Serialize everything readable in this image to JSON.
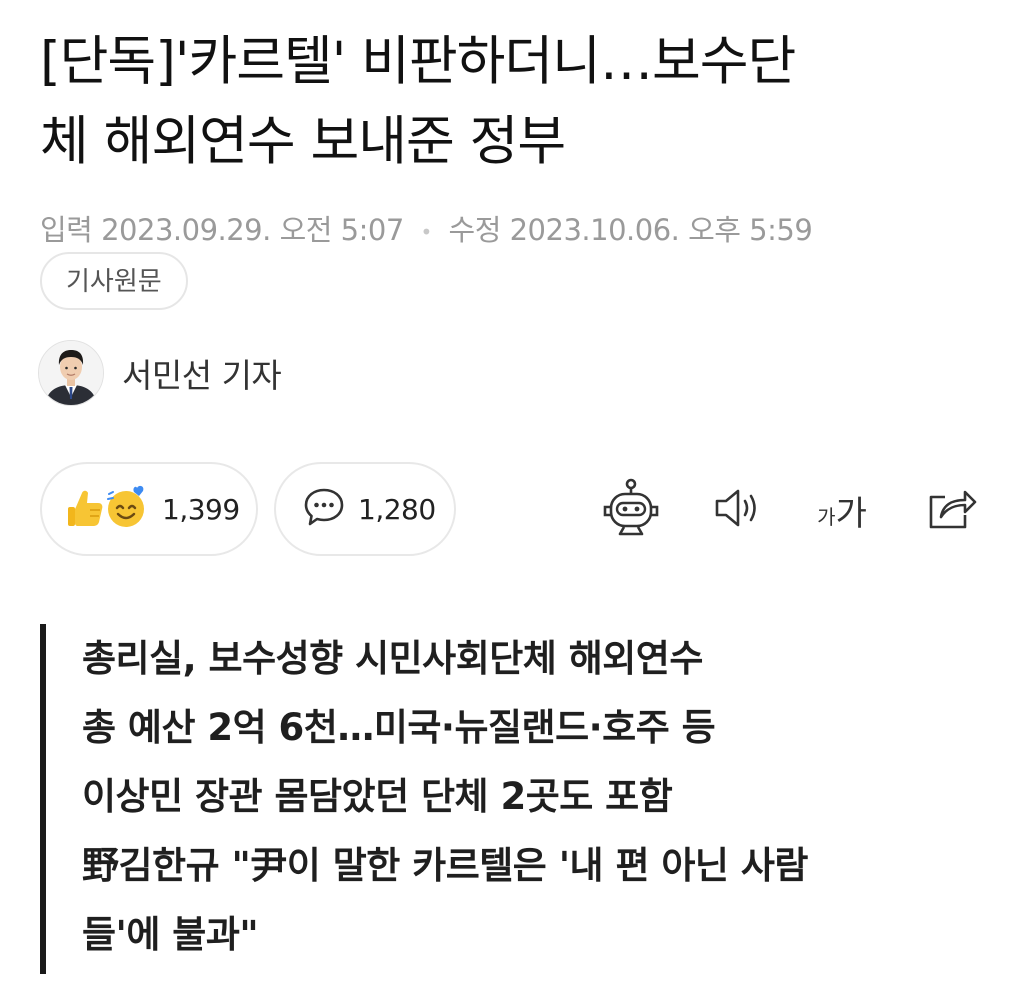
{
  "article": {
    "headline_line1": "[단독]'카르텔' 비판하더니…보수단",
    "headline_line2": "체 해외연수 보내준 정부",
    "input_label": "입력",
    "input_datetime": "2023.09.29. 오전 5:07",
    "modified_label": "수정",
    "modified_datetime": "2023.10.06. 오후 5:59",
    "source_button_label": "기사원문"
  },
  "author": {
    "name": "서민선 기자",
    "avatar_icon": "reporter-photo"
  },
  "reactions": {
    "reaction_count": "1,399",
    "comment_count": "1,280",
    "reaction_icons": [
      "thumbs-up-emoji-icon",
      "smile-emoji-icon"
    ],
    "comment_icon": "speech-bubble-icon"
  },
  "toolbar": {
    "bot_icon": "robot-summary-icon",
    "speaker_icon": "speaker-icon",
    "font_small": "가",
    "font_large": "가",
    "share_icon": "share-icon"
  },
  "summary": {
    "lines": [
      "총리실, 보수성향 시민사회단체 해외연수",
      "총 예산 2억 6천…미국·뉴질랜드·호주 등",
      "이상민 장관 몸담았던 단체 2곳도 포함",
      "野김한규 \"尹이 말한 카르텔은 '내 편 아닌 사람",
      "들'에 불과\""
    ]
  },
  "colors": {
    "text_primary": "#111111",
    "text_meta": "#9a9a9a",
    "pill_border": "#e8e8e8",
    "emoji_yellow": "#f7c534",
    "emoji_blue": "#3d8bf2",
    "summary_bar": "#1a1a1a"
  }
}
